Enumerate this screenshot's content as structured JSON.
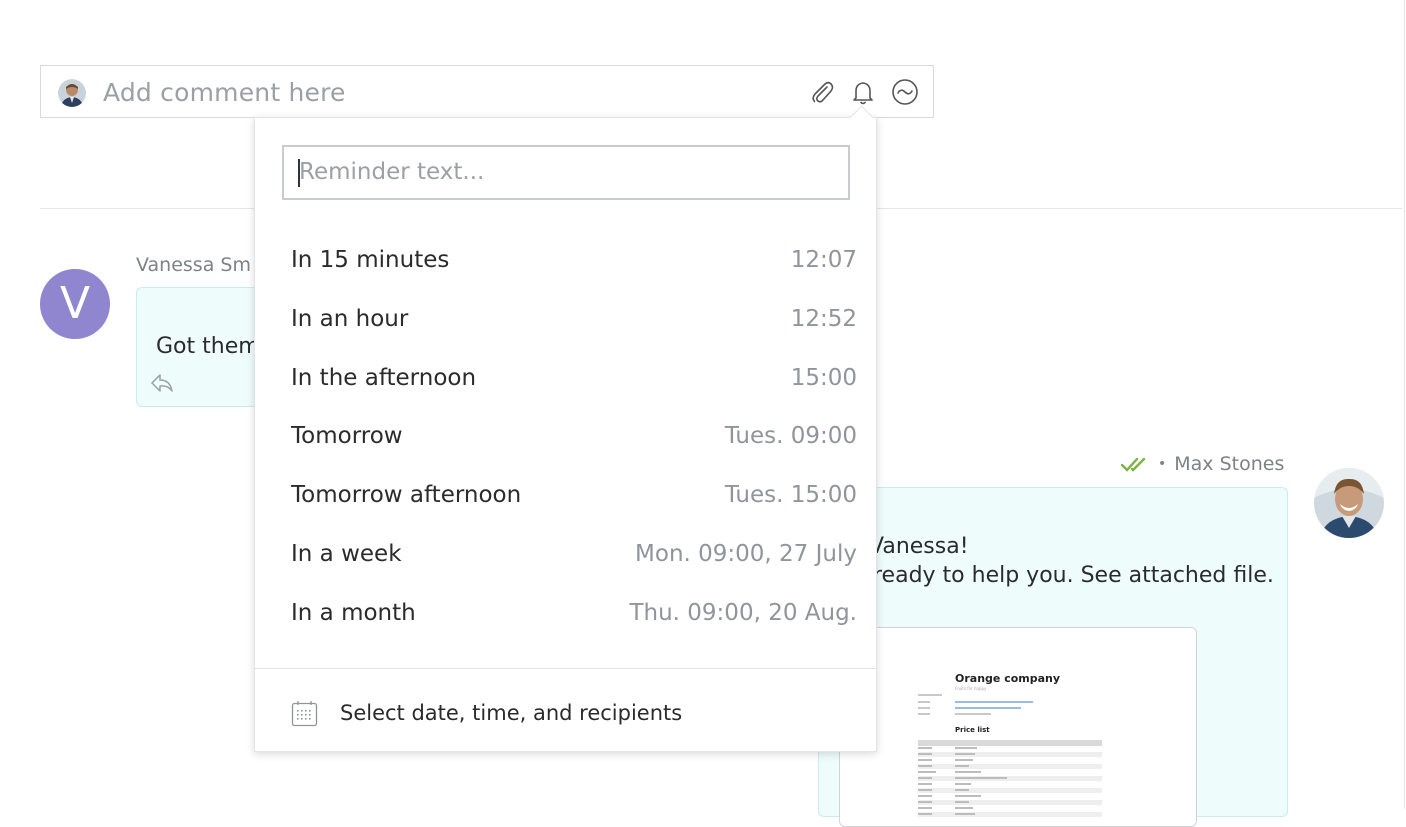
{
  "comment_bar": {
    "placeholder": "Add comment here",
    "icons": [
      "paperclip-icon",
      "bell-icon",
      "smiley-icon"
    ]
  },
  "messages": {
    "vanessa": {
      "avatar_letter": "V",
      "name": "Vanessa Sm",
      "text": "Got them",
      "avatar_color": "#8f86cf"
    },
    "max": {
      "name": "Max Stones",
      "status_icon": "double-check-icon",
      "line1": "Vanessa!",
      "line2": "ready to help you. See attached file.",
      "attachment": {
        "title": "Orange company",
        "subtitle": "Fruits for happy",
        "section": "Price list"
      }
    }
  },
  "reminder_popup": {
    "placeholder": "Reminder text...",
    "options": [
      {
        "label": "In 15 minutes",
        "time": "12:07"
      },
      {
        "label": "In an hour",
        "time": "12:52"
      },
      {
        "label": "In the afternoon",
        "time": "15:00"
      },
      {
        "label": "Tomorrow",
        "time": "Tues. 09:00"
      },
      {
        "label": "Tomorrow afternoon",
        "time": "Tues. 15:00"
      },
      {
        "label": "In a week",
        "time": "Mon. 09:00, 27 July"
      },
      {
        "label": "In a month",
        "time": "Thu. 09:00, 20 Aug."
      }
    ],
    "footer_label": "Select date, time, and recipients",
    "footer_icon": "calendar-icon"
  },
  "colors": {
    "bubble_bg": "#effcfc",
    "bubble_border": "#c7eeee",
    "check_green": "#7cb342"
  }
}
